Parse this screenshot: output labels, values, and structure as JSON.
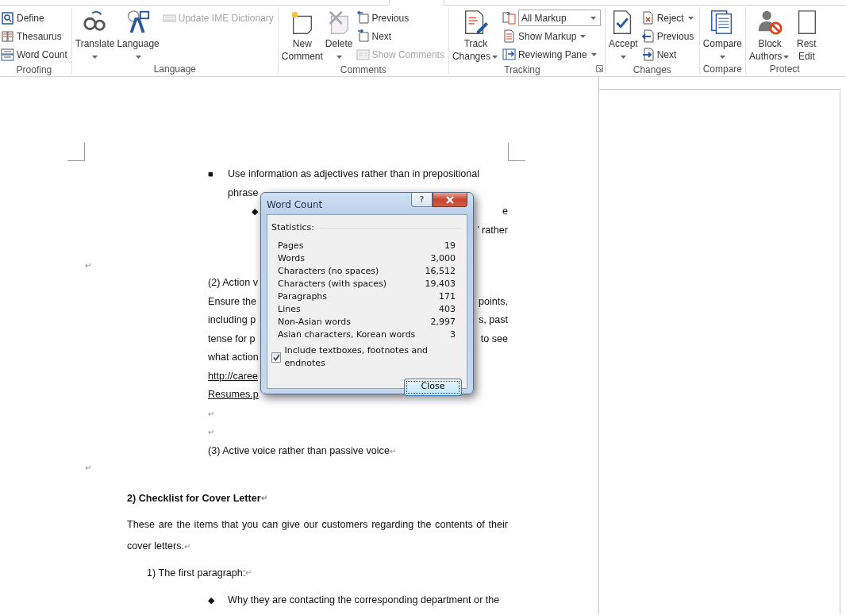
{
  "ribbon": {
    "groups": [
      {
        "label": "Proofing",
        "launcher": false,
        "items": [
          {
            "kind": "small-column",
            "items": [
              {
                "kind": "button",
                "label": "Define",
                "disabled": false,
                "dropdown": false
              },
              {
                "kind": "button",
                "label": "Thesaurus",
                "disabled": false,
                "dropdown": false
              },
              {
                "kind": "button",
                "label": "Word Count",
                "disabled": false,
                "dropdown": false
              }
            ]
          }
        ]
      },
      {
        "label": "Language",
        "launcher": false,
        "items": [
          {
            "kind": "large",
            "lines": [
              "Translate"
            ],
            "dropdown": true
          },
          {
            "kind": "large",
            "lines": [
              "Language"
            ],
            "dropdown": true
          },
          {
            "kind": "small-column",
            "items": [
              {
                "kind": "button",
                "label": "Update IME Dictionary",
                "disabled": true,
                "dropdown": false
              }
            ]
          }
        ]
      },
      {
        "label": "Comments",
        "launcher": false,
        "items": [
          {
            "kind": "large",
            "lines": [
              "New",
              "Comment"
            ],
            "dropdown": false
          },
          {
            "kind": "large",
            "lines": [
              "Delete"
            ],
            "dropdown": true
          },
          {
            "kind": "small-column",
            "items": [
              {
                "kind": "button",
                "label": "Previous",
                "disabled": false,
                "dropdown": false
              },
              {
                "kind": "button",
                "label": "Next",
                "disabled": false,
                "dropdown": false
              },
              {
                "kind": "button",
                "label": "Show Comments",
                "disabled": true,
                "dropdown": false
              }
            ]
          }
        ]
      },
      {
        "label": "Tracking",
        "launcher": true,
        "items": [
          {
            "kind": "large",
            "lines": [
              "Track",
              "Changes"
            ],
            "dropdown": true
          },
          {
            "kind": "small-column",
            "items": [
              {
                "kind": "select",
                "label": "All Markup",
                "disabled": false,
                "dropdown": true
              },
              {
                "kind": "button",
                "label": "Show Markup",
                "disabled": false,
                "dropdown": true
              },
              {
                "kind": "button",
                "label": "Reviewing Pane",
                "disabled": false,
                "dropdown": true
              }
            ]
          }
        ]
      },
      {
        "label": "Changes",
        "launcher": false,
        "items": [
          {
            "kind": "large",
            "lines": [
              "Accept"
            ],
            "dropdown": true
          },
          {
            "kind": "small-column",
            "items": [
              {
                "kind": "button",
                "label": "Reject",
                "disabled": false,
                "dropdown": true
              },
              {
                "kind": "button",
                "label": "Previous",
                "disabled": false,
                "dropdown": false
              },
              {
                "kind": "button",
                "label": "Next",
                "disabled": false,
                "dropdown": false
              }
            ]
          }
        ]
      },
      {
        "label": "Compare",
        "launcher": false,
        "items": [
          {
            "kind": "large",
            "lines": [
              "Compare"
            ],
            "dropdown": true
          }
        ]
      },
      {
        "label": "Protect",
        "launcher": false,
        "items": [
          {
            "kind": "large",
            "lines": [
              "Block",
              "Authors"
            ],
            "dropdown": true
          },
          {
            "kind": "large",
            "lines": [
              "Rest",
              "Edit"
            ],
            "dropdown": false
          }
        ]
      }
    ]
  },
  "document": {
    "lines": [
      {
        "kind": "bullet",
        "bullet": "■",
        "text": "Use information as adjectives rather than in prepositional"
      },
      {
        "kind": "hanging",
        "text": "phrase"
      },
      {
        "kind": "sub-bullet",
        "bullet": "◆",
        "right": "e"
      },
      {
        "kind": "split",
        "right": "’ rather"
      },
      {
        "kind": "outdent-mark",
        "mark": "↵"
      },
      {
        "kind": "split",
        "left": "(2) Action v"
      },
      {
        "kind": "split",
        "left": "Ensure the",
        "right": "points,"
      },
      {
        "kind": "split",
        "left": "including p",
        "right": "s, past"
      },
      {
        "kind": "split",
        "left": "tense for p",
        "right": "to see"
      },
      {
        "kind": "split",
        "left": "what action"
      },
      {
        "kind": "link",
        "left": "http://caree"
      },
      {
        "kind": "link",
        "left": "Resumes.p"
      },
      {
        "kind": "split",
        "mark": "↵"
      },
      {
        "kind": "split",
        "mark": "↵"
      },
      {
        "kind": "split",
        "left": "(3) Active voice rather than passive voice",
        "mark": "↵"
      },
      {
        "kind": "outdent-mark",
        "mark": "↵"
      },
      {
        "kind": "heading",
        "text": "2) Checklist for Cover Letter",
        "mark": "↵"
      },
      {
        "kind": "body-justified",
        "text": "These are the items that you can give our customers regarding the contents of their"
      },
      {
        "kind": "body",
        "text": "cover letters. ",
        "mark": "↵"
      },
      {
        "kind": "numbered",
        "text": "1) The first paragraph: ",
        "mark": "↵"
      },
      {
        "kind": "bullet",
        "bullet": "◆",
        "text": "Why they are contacting the corresponding department or the"
      }
    ]
  },
  "dialog": {
    "title": "Word Count",
    "help": "?",
    "section": "Statistics:",
    "stats": [
      {
        "label": "Pages",
        "value": "19"
      },
      {
        "label": "Words",
        "value": "3,000"
      },
      {
        "label": "Characters (no spaces)",
        "value": "16,512"
      },
      {
        "label": "Characters (with spaces)",
        "value": "19,403"
      },
      {
        "label": "Paragraphs",
        "value": "171"
      },
      {
        "label": "Lines",
        "value": "403"
      },
      {
        "label": "Non-Asian words",
        "value": "2,997"
      },
      {
        "label": "Asian characters, Korean words",
        "value": "3"
      }
    ],
    "checkbox": {
      "label": "Include textboxes, footnotes and endnotes",
      "checked": true
    },
    "button": "Close"
  }
}
